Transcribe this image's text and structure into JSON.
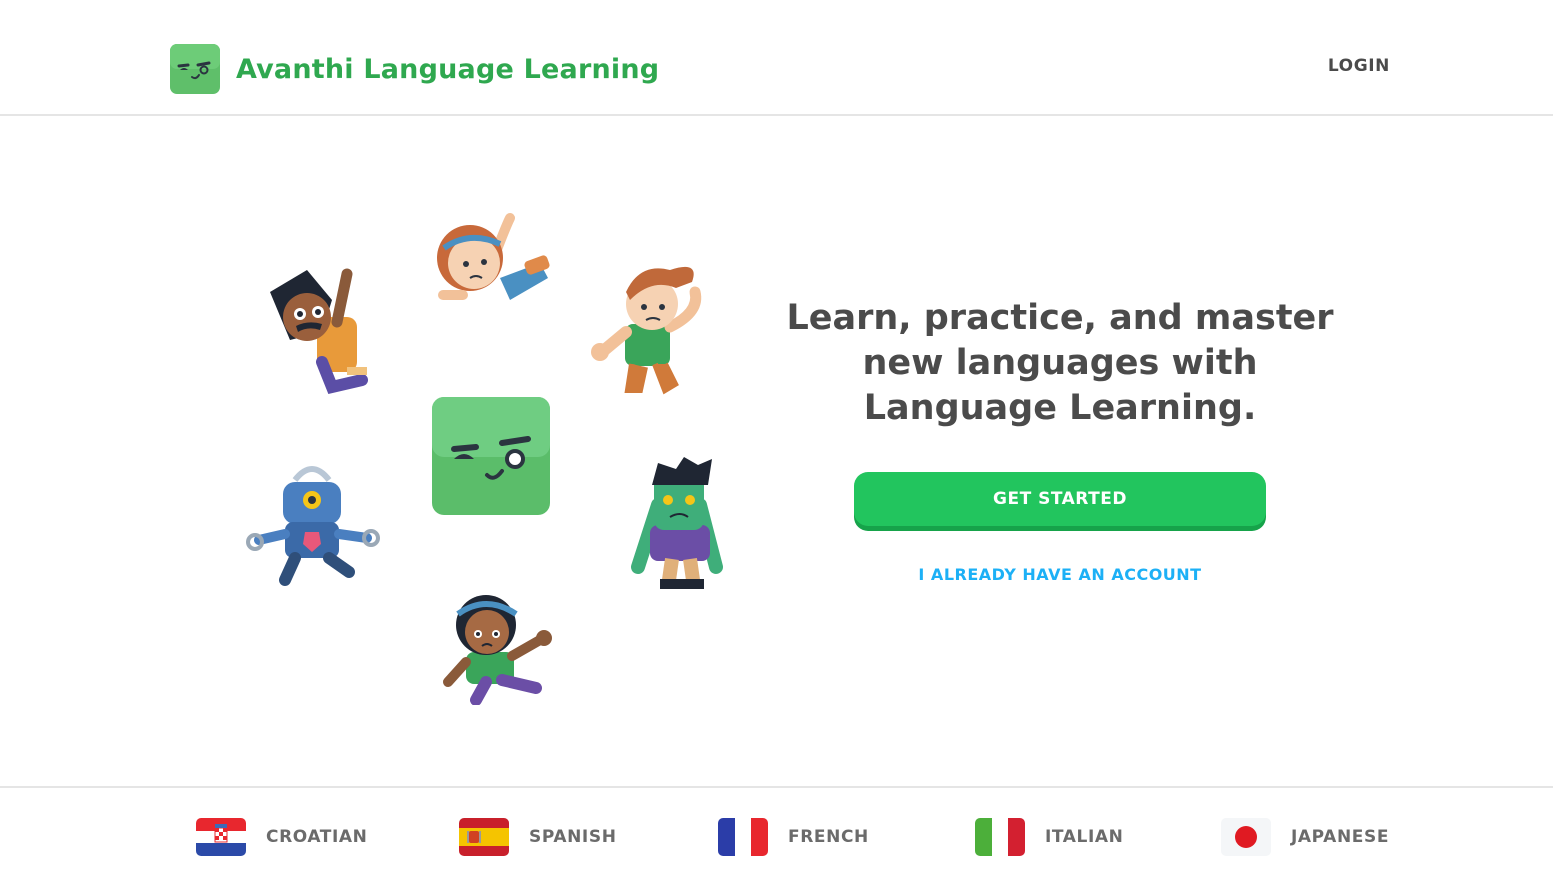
{
  "header": {
    "brand": "Avanthi Language Learning",
    "login_label": "LOGIN"
  },
  "hero": {
    "headline": "Learn, practice, and master new languages with Language Learning.",
    "get_started_label": "GET STARTED",
    "account_link_label": "I ALREADY HAVE AN ACCOUNT"
  },
  "languages": [
    {
      "label": "CROATIAN",
      "flag": "croatia-flag"
    },
    {
      "label": "SPANISH",
      "flag": "spain-flag"
    },
    {
      "label": "FRENCH",
      "flag": "france-flag"
    },
    {
      "label": "ITALIAN",
      "flag": "italy-flag"
    },
    {
      "label": "JAPANESE",
      "flag": "japan-flag"
    }
  ],
  "colors": {
    "brand_green": "#2fa84f",
    "button_green": "#22c55e",
    "link_blue": "#1cb0f6",
    "text_dark": "#4b4b4b"
  }
}
